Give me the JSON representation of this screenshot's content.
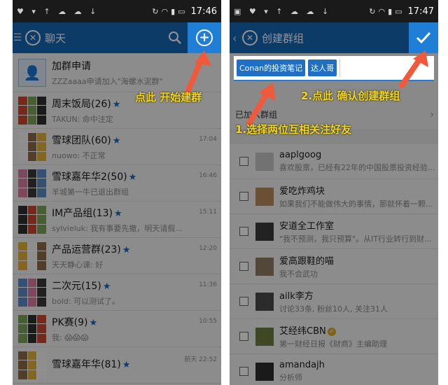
{
  "left": {
    "statusbar": {
      "icons": "♥ ▾ ↑ ☁ ☁ ↓",
      "time": "17:46"
    },
    "appbar": {
      "menu": "☰",
      "title": "聊天"
    },
    "chats": [
      {
        "name": "加群申请",
        "msg": "ZZZaaaa申请加入\"海螺水泥群\"",
        "time": "",
        "star": false,
        "avatar": "single"
      },
      {
        "name": "周末饭局(26)",
        "msg": "TAKUN: 命中注定",
        "time": "",
        "star": true,
        "avatar": "grid"
      },
      {
        "name": "雪球团队(60)",
        "msg": "nuowo: 不正常",
        "time": "17:04",
        "star": true,
        "avatar": "grid"
      },
      {
        "name": "雪球嘉年华2(50)",
        "msg": "羊城第一牛已退出群组",
        "time": "16:46",
        "star": true,
        "avatar": "grid"
      },
      {
        "name": "IM产品组(13)",
        "msg": "sylvieluk: 我有事要先撤，明天请假...",
        "time": "15:11",
        "star": true,
        "avatar": "grid"
      },
      {
        "name": "产品运营群(23)",
        "msg": "天天静心课: 好",
        "time": "12:20",
        "star": true,
        "avatar": "grid"
      },
      {
        "name": "二次元(15)",
        "msg": "bold: 可以测试了。",
        "time": "11:36",
        "star": true,
        "avatar": "grid"
      },
      {
        "name": "PK赛(9)",
        "msg": "我: 😱😱😱",
        "time": "10:55",
        "star": true,
        "avatar": "grid"
      },
      {
        "name": "雪球嘉年华(81)",
        "msg": "",
        "time": "前天 22:52",
        "star": true,
        "avatar": "grid"
      }
    ],
    "annotation": "点此  开始建群"
  },
  "right": {
    "statusbar": {
      "icons": "▣ ♥ ▾ ↑ ☁ ☁ ↓",
      "time": "17:47"
    },
    "appbar": {
      "back": "‹",
      "title": "创建群组"
    },
    "chips": [
      "Conan的投资笔记",
      "达人哥"
    ],
    "joined_label": "已加入群组",
    "users": [
      {
        "name": "aaplgoog",
        "desc": "喜欢股票，已经有22年的中国股票投资经验...",
        "verified": false
      },
      {
        "name": "爱吃炸鸡块",
        "desc": "如果我们不能做伟大的事情，那就怀着一颗...",
        "verified": false
      },
      {
        "name": "安道全工作室",
        "desc": "\"我不预测，我只预算\"。从IT行业转行到财...",
        "verified": false
      },
      {
        "name": "爱高跟鞋的喵",
        "desc": "我不会武功",
        "verified": false
      },
      {
        "name": "ailk李方",
        "desc": "讨论33条, 粉丝10人, 关注31人",
        "verified": false
      },
      {
        "name": "艾经纬CBN",
        "desc": "第一财经日报《财商》主编助理",
        "verified": true
      },
      {
        "name": "amandajh",
        "desc": "分析师",
        "verified": false
      }
    ],
    "annotation_1": "1.选择两位互相关注好友",
    "annotation_2": "2.点此  确认创建群组"
  },
  "colors": {
    "accent": "#1667b3",
    "highlight": "#1f7fd6",
    "annotation": "#f5d716",
    "arrow": "#f05a3c"
  }
}
